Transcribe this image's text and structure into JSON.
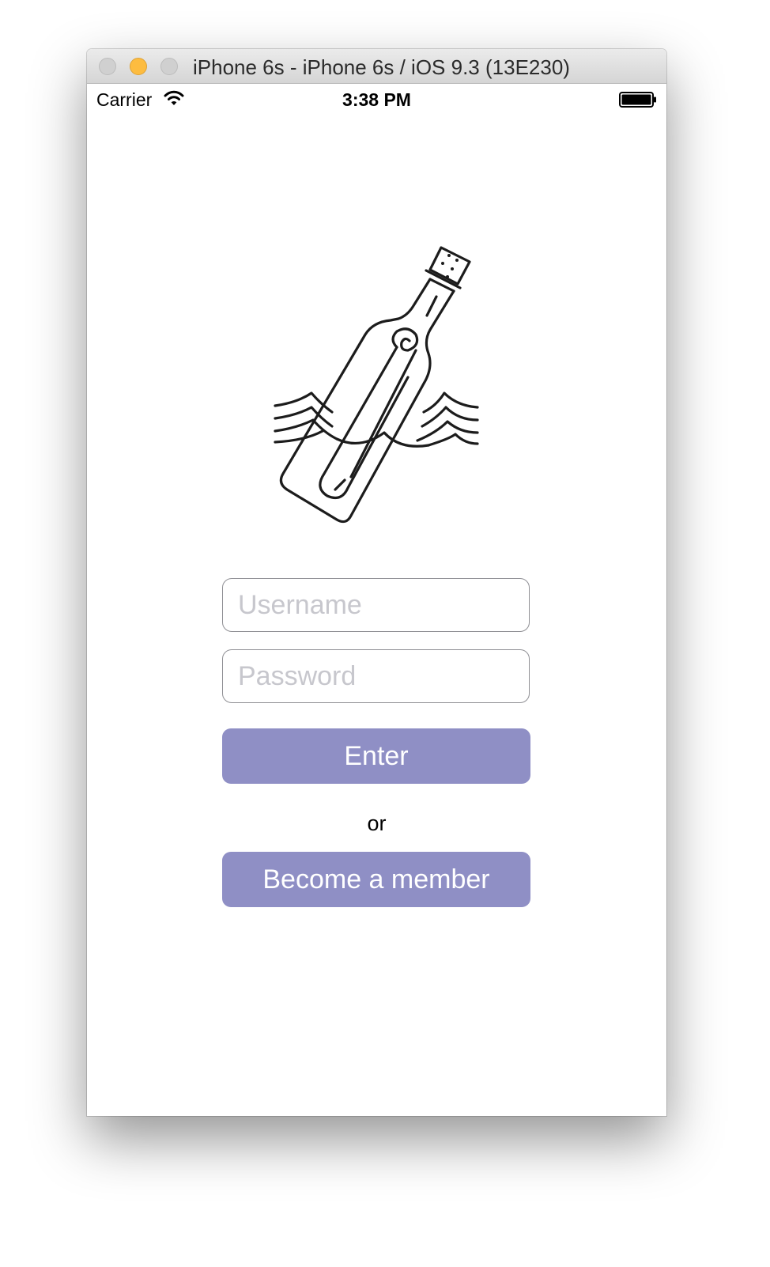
{
  "window": {
    "title": "iPhone 6s - iPhone 6s / iOS 9.3 (13E230)"
  },
  "status_bar": {
    "carrier": "Carrier",
    "time": "3:38 PM",
    "icons": [
      "wifi-icon",
      "battery-icon"
    ]
  },
  "logo": {
    "icon": "message-in-a-bottle-icon"
  },
  "login": {
    "username_placeholder": "Username",
    "password_placeholder": "Password",
    "enter_label": "Enter",
    "or_label": "or",
    "member_label": "Become a member"
  },
  "colors": {
    "button": "#8f8fc5",
    "button_text": "#ffffff",
    "traffic_minimize": "#fdbc40"
  }
}
